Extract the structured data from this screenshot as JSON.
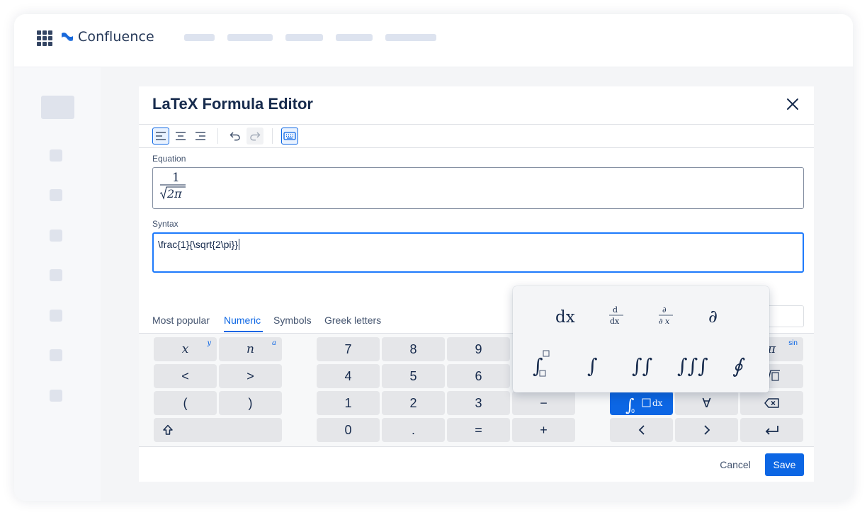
{
  "app": {
    "name": "Confluence",
    "brand_color": "#1868db",
    "icons": {
      "apps": "apps-grid-icon",
      "logo": "confluence-logo-icon"
    }
  },
  "dialog": {
    "title": "LaTeX Formula Editor",
    "close_icon": "close-icon",
    "toolbar": {
      "items": [
        {
          "name": "align-left-icon",
          "active": true
        },
        {
          "name": "align-center-icon",
          "active": false
        },
        {
          "name": "align-right-icon",
          "active": false
        },
        {
          "name": "undo-icon",
          "active": false
        },
        {
          "name": "redo-icon",
          "active": false,
          "disabled": true
        },
        {
          "name": "keyboard-icon",
          "active": true
        }
      ]
    },
    "equation": {
      "label": "Equation",
      "numerator": "1",
      "radicand": "2π"
    },
    "syntax": {
      "label": "Syntax",
      "value": "\\frac{1}{\\sqrt{2\\pi}}"
    },
    "tabs": [
      {
        "label": "Most popular",
        "active": false
      },
      {
        "label": "Numeric",
        "active": true
      },
      {
        "label": "Symbols",
        "active": false
      },
      {
        "label": "Greek letters",
        "active": false
      }
    ],
    "keyboard": {
      "left": {
        "x_main": "x",
        "x_sup": "y",
        "n_main": "n",
        "n_sup": "a",
        "lt": "<",
        "gt": ">",
        "lparen": "(",
        "rparen": ")",
        "shift_icon": "shift-arrow-icon"
      },
      "numpad": {
        "row1": [
          "7",
          "8",
          "9"
        ],
        "row2": [
          "4",
          "5",
          "6"
        ],
        "row3": [
          "1",
          "2",
          "3",
          "−"
        ],
        "row4": [
          "0",
          ".",
          "=",
          "+"
        ]
      },
      "right": {
        "pi": "π",
        "sin": "sin",
        "forall": "∀",
        "integral_key_suffix": "dx",
        "integral_key_lower": "0",
        "icons": [
          "sqrt-box-icon",
          "backspace-icon",
          "arrow-left-icon",
          "arrow-right-icon",
          "return-icon"
        ]
      }
    },
    "footer": {
      "cancel_label": "Cancel",
      "save_label": "Save"
    }
  },
  "popup": {
    "row1": [
      "dx",
      "d/dx",
      "∂/∂x",
      "∂"
    ],
    "row2": [
      "definite-integral-icon",
      "integral-icon",
      "double-integral-icon",
      "triple-integral-icon",
      "contour-integral-icon"
    ],
    "text": {
      "d": "d",
      "x": "x",
      "dx": "dx",
      "partial": "∂"
    }
  }
}
